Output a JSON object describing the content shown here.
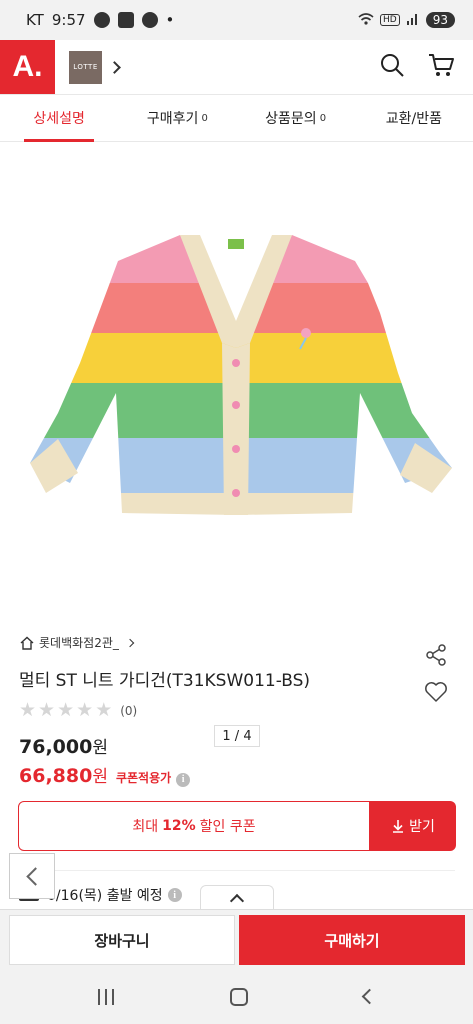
{
  "status_bar": {
    "carrier": "KT",
    "time": "9:57",
    "battery": "93",
    "hd_label": "HD"
  },
  "header": {
    "logo_text": "A.",
    "brand_badge": "LOTTE",
    "search_icon": "search-icon",
    "cart_icon": "cart-icon"
  },
  "tabs": [
    {
      "label": "상세설명",
      "count": "",
      "active": true
    },
    {
      "label": "구매후기",
      "count": "0",
      "active": false
    },
    {
      "label": "상품문의",
      "count": "0",
      "active": false
    },
    {
      "label": "교환/반품",
      "count": "",
      "active": false
    }
  ],
  "gallery": {
    "pager": "1 / 4"
  },
  "product": {
    "store": "롯데백화점2관_",
    "title": "멀티 ST 니트 가디건(T31KSW011-BS)",
    "rating_count": "(0)",
    "rating_stars": 0,
    "original_price": "76,000",
    "original_currency": "원",
    "sale_price": "66,880",
    "sale_currency": "원",
    "coupon_note": "쿠폰적용가"
  },
  "coupon": {
    "prefix": "최대",
    "percent": "12%",
    "suffix": "할인 쿠폰",
    "download_label": "받기"
  },
  "shipping": {
    "text": "0/16(목) 출발 예정"
  },
  "bottom": {
    "cart_label": "장바구니",
    "buy_label": "구매하기"
  },
  "colors": {
    "accent": "#e4282f"
  }
}
